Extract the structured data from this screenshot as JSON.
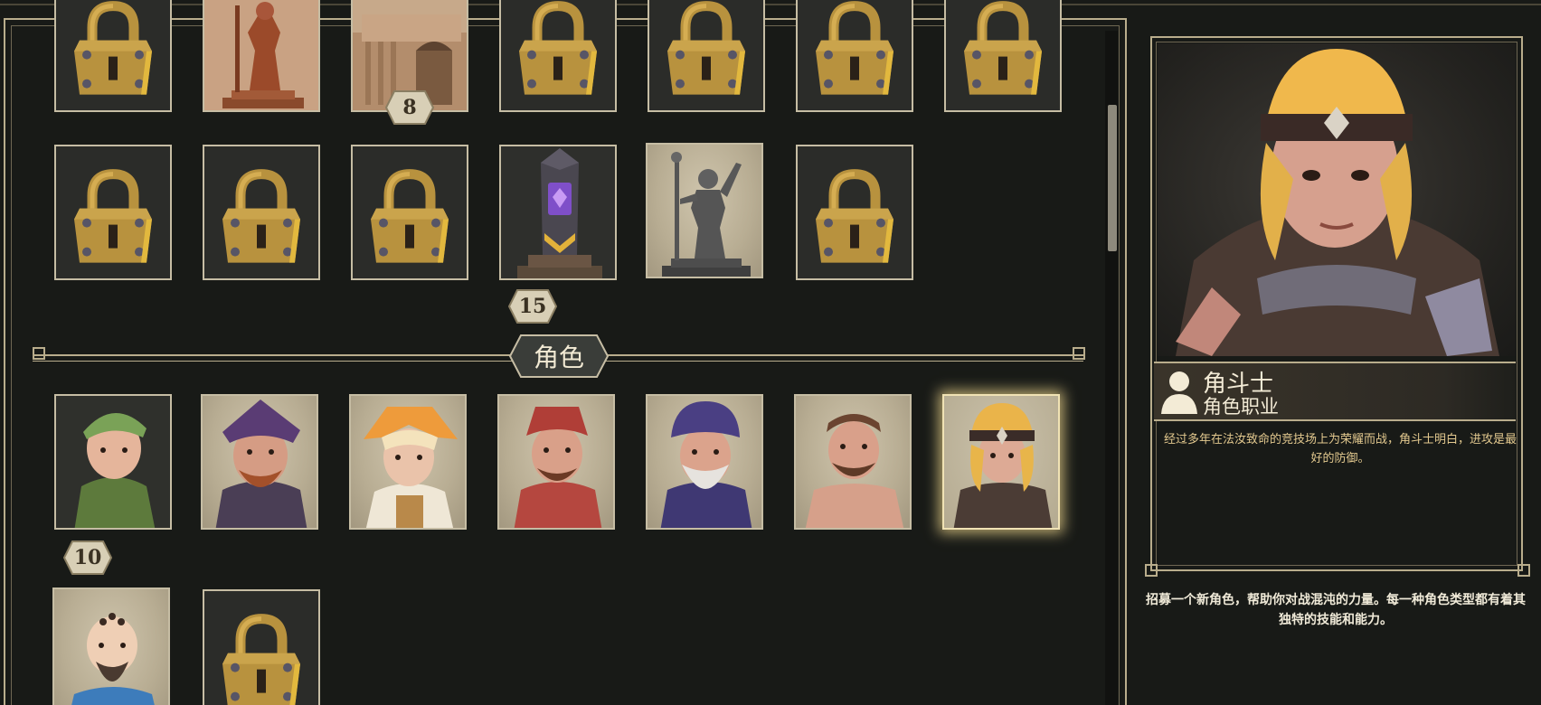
{
  "collections": {
    "row1": [
      {
        "state": "locked"
      },
      {
        "state": "unlocked",
        "icon": "warrior-statue-icon"
      },
      {
        "state": "unlocked",
        "icon": "castle-building-icon",
        "badge": "8"
      },
      {
        "state": "locked"
      },
      {
        "state": "locked"
      },
      {
        "state": "locked"
      },
      {
        "state": "locked"
      }
    ],
    "row2": [
      {
        "state": "locked"
      },
      {
        "state": "locked"
      },
      {
        "state": "locked"
      },
      {
        "state": "unlocked",
        "icon": "crystal-obelisk-icon",
        "badge": "15"
      },
      {
        "state": "unlocked",
        "icon": "staff-statue-icon"
      },
      {
        "state": "locked"
      }
    ]
  },
  "section": {
    "title": "角色"
  },
  "characters": {
    "row1": [
      {
        "portrait": "green-hood-archer-portrait",
        "badge": "10"
      },
      {
        "portrait": "purple-hat-rogue-portrait"
      },
      {
        "portrait": "orange-hat-maiden-portrait"
      },
      {
        "portrait": "red-cap-adventurer-portrait"
      },
      {
        "portrait": "purple-turban-wizard-portrait"
      },
      {
        "portrait": "bare-chested-brawler-portrait"
      },
      {
        "portrait": "gladiator-portrait",
        "selected": true
      }
    ],
    "row2": [
      {
        "portrait": "bald-monk-portrait"
      },
      {
        "state": "locked"
      }
    ]
  },
  "detail": {
    "name": "角斗士",
    "subtitle": "角色职业",
    "description": "经过多年在法汝致命的竞技场上为荣耀而战，角斗士明白，进攻是最好的防御。",
    "footer": "招募一个新角色，帮助你对战混沌的力量。每一种角色类型都有着其独特的技能和能力。"
  },
  "colors": {
    "accent_gold": "#e3c98f",
    "frame": "#b9ad8c",
    "background": "#181a17"
  }
}
